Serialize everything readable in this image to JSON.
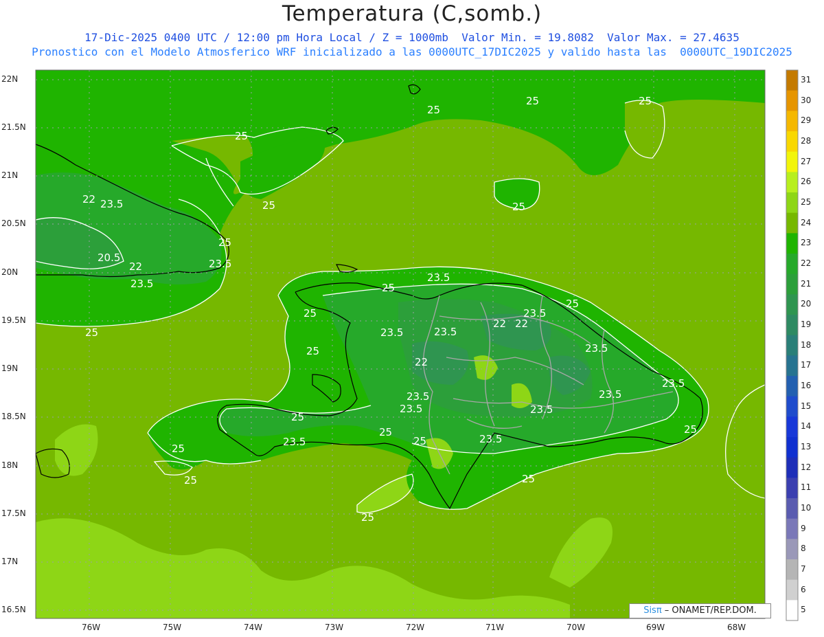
{
  "header": {
    "title": "Temperatura (C,somb.)",
    "line1": "17-Dic-2025 0400 UTC / 12:00 pm Hora Local / Z = 1000mb  Valor Min. = 19.8082  Valor Max. = 27.4635",
    "line2": "Pronostico con el Modelo Atmosferico WRF inicializado a las 0000UTC_17DIC2025 y valido hasta las  0000UTC_19DIC2025"
  },
  "axes": {
    "lat_labels": [
      "22N",
      "21.5N",
      "21N",
      "20.5N",
      "20N",
      "19.5N",
      "19N",
      "18.5N",
      "18N",
      "17.5N",
      "17N",
      "16.5N"
    ],
    "lon_labels": [
      "76W",
      "75W",
      "74W",
      "73W",
      "72W",
      "71W",
      "70W",
      "69W",
      "68W"
    ]
  },
  "contour_labels": {
    "c25": "25",
    "c23_5": "23.5",
    "c22": "22",
    "c20_5": "20.5"
  },
  "colorbar": {
    "levels": [
      "31",
      "30",
      "29",
      "28",
      "27",
      "26",
      "25",
      "24",
      "23",
      "22",
      "21",
      "20",
      "19",
      "18",
      "17",
      "16",
      "15",
      "14",
      "13",
      "12",
      "11",
      "10",
      "9",
      "8",
      "7",
      "6",
      "5"
    ],
    "colors": [
      "#c47a00",
      "#e69500",
      "#f5b800",
      "#f9d800",
      "#f2f50a",
      "#b8ef1e",
      "#8ed616",
      "#76b800",
      "#1fb400",
      "#26a92a",
      "#2c9f3a",
      "#2f9550",
      "#2e8a62",
      "#2a7f78",
      "#277390",
      "#2360b0",
      "#1f4ccc",
      "#1838d8",
      "#1030d0",
      "#1e2eb8",
      "#3b3fb0",
      "#5a5cb0",
      "#7a78b8",
      "#9a98b8",
      "#b5b5b5",
      "#d0d0d0",
      "#ffffff"
    ]
  },
  "credit": {
    "sis": "Sisπ",
    "text": " – ONAMET/REP.DOM."
  }
}
